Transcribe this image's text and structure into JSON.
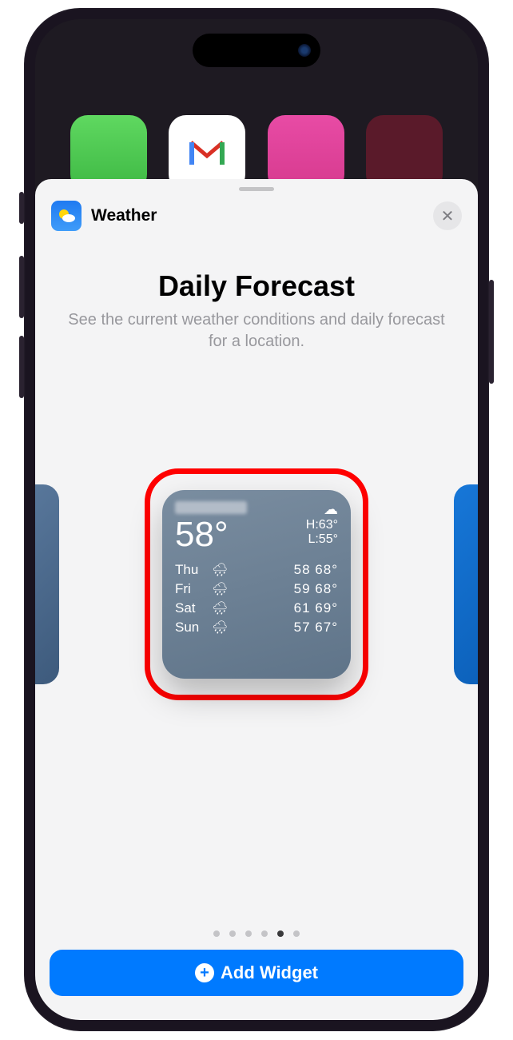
{
  "header": {
    "app_name": "Weather",
    "close_label": "✕"
  },
  "widget": {
    "title": "Daily Forecast",
    "description": "See the current weather conditions and daily forecast for a location."
  },
  "preview": {
    "current_temp": "58°",
    "high": "H:63°",
    "low": "L:55°",
    "condition_icon": "☁",
    "days": [
      {
        "name": "Thu",
        "icon": "🌧",
        "low": "58",
        "high": "68°"
      },
      {
        "name": "Fri",
        "icon": "🌧",
        "low": "59",
        "high": "68°"
      },
      {
        "name": "Sat",
        "icon": "🌧",
        "low": "61",
        "high": "69°"
      },
      {
        "name": "Sun",
        "icon": "🌧",
        "low": "57",
        "high": "67°"
      }
    ]
  },
  "pager": {
    "total": 6,
    "active": 5
  },
  "button": {
    "add_label": "Add Widget"
  }
}
